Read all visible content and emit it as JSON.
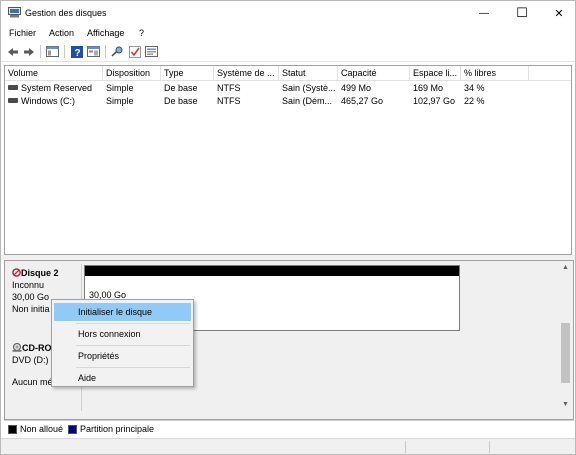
{
  "window": {
    "title": "Gestion des disques",
    "minimize_glyph": "—",
    "maximize_glyph": "☐",
    "close_glyph": "✕"
  },
  "menu": {
    "items": [
      "Fichier",
      "Action",
      "Affichage",
      "?"
    ]
  },
  "toolbar": {
    "icons": [
      "back-arrow-icon",
      "forward-arrow-icon",
      "console-tree-icon",
      "help-icon",
      "properties-icon",
      "connect-icon",
      "checkmark-icon",
      "options-icon"
    ]
  },
  "volume_list": {
    "columns": [
      "Volume",
      "Disposition",
      "Type",
      "Système de ...",
      "Statut",
      "Capacité",
      "Espace li...",
      "% libres"
    ],
    "rows": [
      [
        "System Reserved",
        "Simple",
        "De base",
        "NTFS",
        "Sain (Systè...",
        "499 Mo",
        "169 Mo",
        "34 %"
      ],
      [
        "Windows (C:)",
        "Simple",
        "De base",
        "NTFS",
        "Sain (Dém...",
        "465,27 Go",
        "102,97 Go",
        "22 %"
      ]
    ]
  },
  "disks": {
    "disk2": {
      "name": "Disque 2",
      "type": "Inconnu",
      "size": "30,00 Go",
      "status": "Non initia",
      "partition_size": "30,00 Go"
    },
    "cdrom": {
      "name": "CD-RO",
      "drive": "DVD (D:)",
      "media": "Aucun mé"
    }
  },
  "legend": {
    "unallocated": "Non alloué",
    "primary": "Partition principale",
    "unallocated_color": "#000000",
    "primary_color": "#000080"
  },
  "context_menu": {
    "items": [
      "Initialiser le disque",
      "Hors connexion",
      "Propriétés",
      "Aide"
    ],
    "highlight_color": "#91c9f7"
  }
}
